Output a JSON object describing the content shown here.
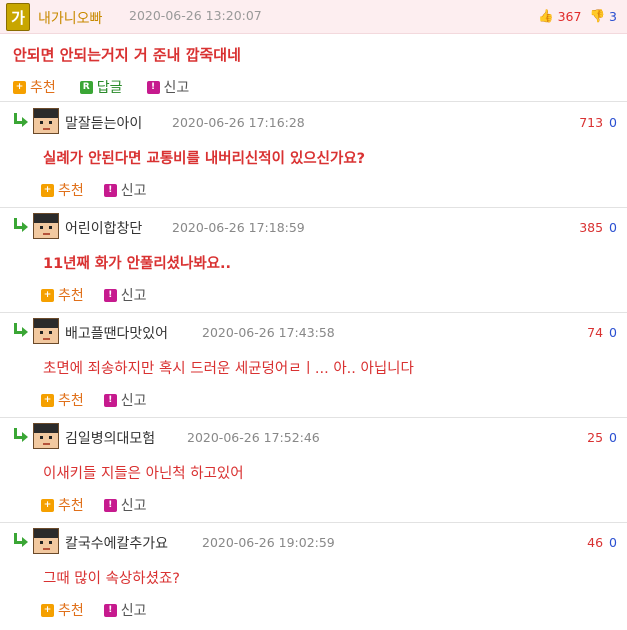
{
  "post": {
    "author": "내가니오빠",
    "avatar_text": "가",
    "date": "2020-06-26 13:20:07",
    "upvotes": "367",
    "downvotes": "3",
    "text": "안되면 안되는거지 거 준내 깝죽대네",
    "actions": {
      "recommend": "추천",
      "reply": "답글",
      "report": "신고"
    }
  },
  "replies": [
    {
      "author": "말잘듣는아이",
      "date": "2020-06-26 17:16:28",
      "up": "713",
      "down": "0",
      "text": "실례가 안된다면 교통비를 내버리신적이 있으신가요?",
      "recommend": "추천",
      "report": "신고"
    },
    {
      "author": "어린이합창단",
      "date": "2020-06-26 17:18:59",
      "up": "385",
      "down": "0",
      "text": "11년째 화가 안풀리셨나봐요..",
      "recommend": "추천",
      "report": "신고"
    },
    {
      "author": "배고플땐다맛있어",
      "date": "2020-06-26 17:43:58",
      "up": "74",
      "down": "0",
      "text": "초면에 죄송하지만 혹시 드러운 세균덩어ㄹㅣ... 아.. 아닙니다",
      "recommend": "추천",
      "report": "신고"
    },
    {
      "author": "김일병의대모험",
      "date": "2020-06-26 17:52:46",
      "up": "25",
      "down": "0",
      "text": "이새키들 지들은 아닌척 하고있어",
      "recommend": "추천",
      "report": "신고"
    },
    {
      "author": "칼국수에칼추가요",
      "date": "2020-06-26 19:02:59",
      "up": "46",
      "down": "0",
      "text": "그때 많이 속상하셨죠?",
      "recommend": "추천",
      "report": "신고"
    }
  ]
}
